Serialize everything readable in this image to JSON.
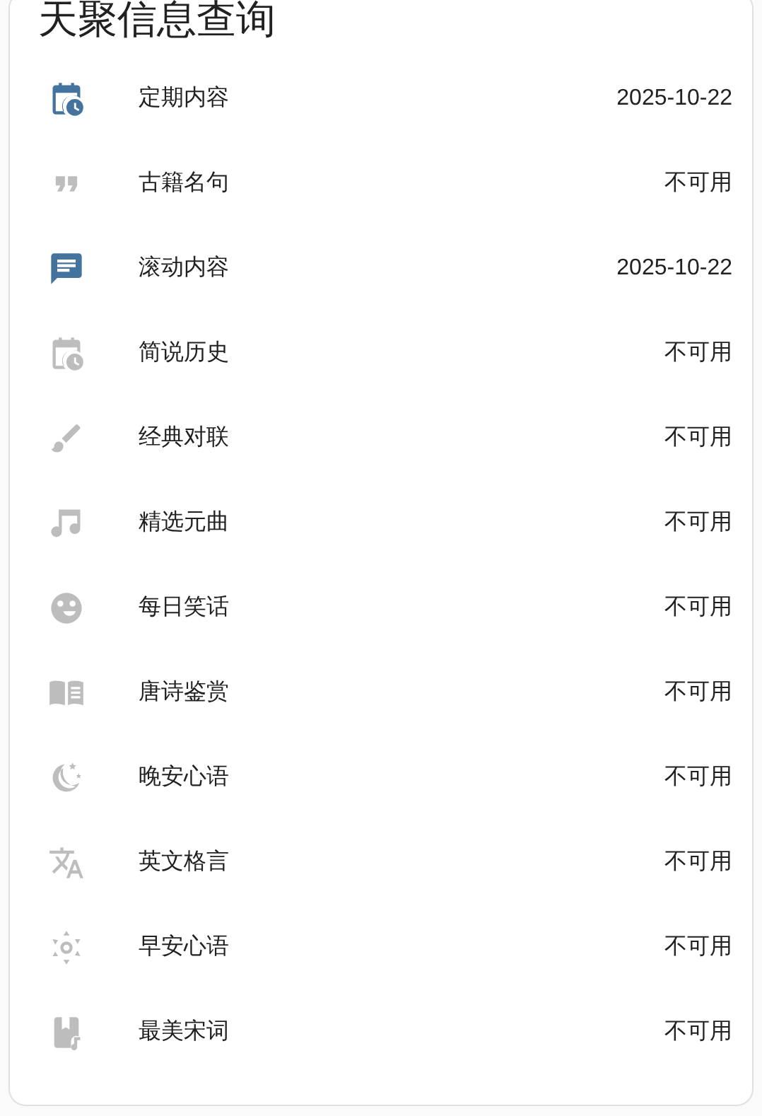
{
  "card": {
    "title": "天聚信息查询",
    "rows": [
      {
        "kind": "calendar-clock",
        "name": "定期内容",
        "value": "2025-10-22",
        "active": true
      },
      {
        "kind": "quote",
        "name": "古籍名句",
        "value": "不可用",
        "active": false
      },
      {
        "kind": "message",
        "name": "滚动内容",
        "value": "2025-10-22",
        "active": true
      },
      {
        "kind": "calendar-clock",
        "name": "简说历史",
        "value": "不可用",
        "active": false
      },
      {
        "kind": "brush",
        "name": "经典对联",
        "value": "不可用",
        "active": false
      },
      {
        "kind": "music",
        "name": "精选元曲",
        "value": "不可用",
        "active": false
      },
      {
        "kind": "emoticon",
        "name": "每日笑话",
        "value": "不可用",
        "active": false
      },
      {
        "kind": "book",
        "name": "唐诗鉴赏",
        "value": "不可用",
        "active": false
      },
      {
        "kind": "moon",
        "name": "晚安心语",
        "value": "不可用",
        "active": false
      },
      {
        "kind": "translate",
        "name": "英文格言",
        "value": "不可用",
        "active": false
      },
      {
        "kind": "sun",
        "name": "早安心语",
        "value": "不可用",
        "active": false
      },
      {
        "kind": "music-book",
        "name": "最美宋词",
        "value": "不可用",
        "active": false
      }
    ]
  }
}
